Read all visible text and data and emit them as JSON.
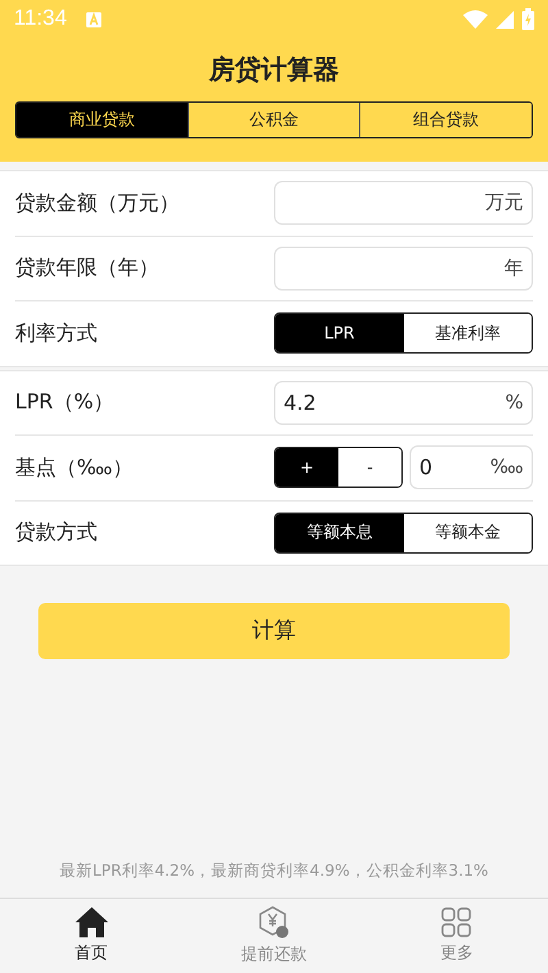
{
  "status_bar": {
    "time": "11:34"
  },
  "title": "房贷计算器",
  "tabs": [
    {
      "label": "商业贷款",
      "selected": true
    },
    {
      "label": "公积金",
      "selected": false
    },
    {
      "label": "组合贷款",
      "selected": false
    }
  ],
  "sections": [
    {
      "rows": [
        {
          "kind": "field",
          "label": "贷款金额（万元）",
          "value": "",
          "unit": "万元"
        },
        {
          "kind": "field",
          "label": "贷款年限（年）",
          "value": "",
          "unit": "年"
        },
        {
          "kind": "segmented",
          "label": "利率方式",
          "options": [
            {
              "label": "LPR",
              "selected": true
            },
            {
              "label": "基准利率",
              "selected": false
            }
          ]
        }
      ]
    },
    {
      "rows": [
        {
          "kind": "field",
          "label": "LPR（%）",
          "value": "4.2",
          "unit": "%"
        },
        {
          "kind": "stepper",
          "label": "基点（‱）",
          "options": [
            {
              "label": "+",
              "selected": true
            },
            {
              "label": "-",
              "selected": false
            }
          ],
          "value": "0",
          "unit": "‱"
        },
        {
          "kind": "segmented",
          "label": "贷款方式",
          "options": [
            {
              "label": "等额本息",
              "selected": true
            },
            {
              "label": "等额本金",
              "selected": false
            }
          ]
        }
      ]
    }
  ],
  "calculate_button": "计算",
  "footer_note": "最新LPR利率4.2%，最新商贷利率4.9%，公积金利率3.1%",
  "bottom_nav": [
    {
      "kind": "home",
      "label": "首页",
      "selected": true
    },
    {
      "kind": "prepay",
      "label": "提前还款",
      "selected": false
    },
    {
      "kind": "more",
      "label": "更多",
      "selected": false
    }
  ]
}
